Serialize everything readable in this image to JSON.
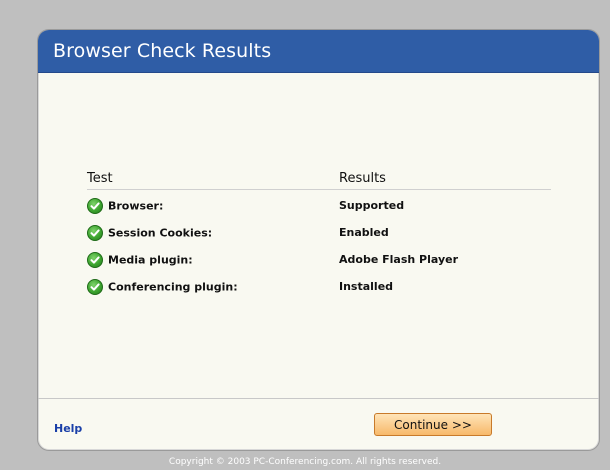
{
  "window": {
    "title": "Browser Check Results"
  },
  "table": {
    "headers": [
      "Test",
      "Results"
    ],
    "rows": [
      {
        "test": "Browser:",
        "result": "Supported",
        "status_icon": "check-circle-icon"
      },
      {
        "test": "Session Cookies:",
        "result": "Enabled",
        "status_icon": "check-circle-icon"
      },
      {
        "test": "Media plugin:",
        "result": "Adobe Flash Player",
        "status_icon": "check-circle-icon"
      },
      {
        "test": "Conferencing plugin:",
        "result": "Installed",
        "status_icon": "check-circle-icon"
      }
    ]
  },
  "footer": {
    "help_label": "Help",
    "continue_label": "Continue >>"
  },
  "copyright": "Copyright © 2003 PC-Conferencing.com. All rights reserved.",
  "colors": {
    "title_bar": "#2f5da6",
    "panel_bg": "#f9f9f1",
    "page_bg": "#bfbfbf",
    "button_bg": "#f7b96a",
    "link": "#1a3fa8",
    "status_ok": "#3da42f"
  }
}
